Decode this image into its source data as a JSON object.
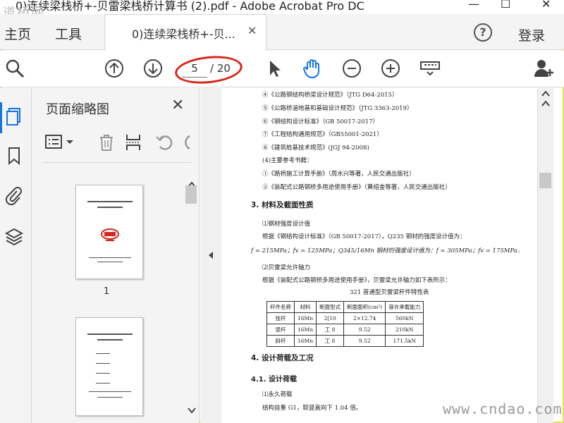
{
  "window": {
    "title": "0)连续梁栈桥+-贝雷梁栈桥计算书 (2).pdf - Adobe Acrobat Pro DC",
    "minimize": "—",
    "maximize": "☐",
    "close": "✕"
  },
  "watermark_top": "道桥网",
  "watermark_bottom": "www.cndao.com",
  "nav": {
    "home": "主页",
    "tools": "工具",
    "login": "登录",
    "help": "?"
  },
  "tab": {
    "label": "0)连续梁栈桥+-贝...",
    "close": "✕"
  },
  "toolbar": {
    "current_page": "5",
    "separator": "/",
    "total_pages": "20",
    "icons": [
      "search-icon",
      "page-up-icon",
      "page-down-icon",
      "select-arrow-icon",
      "hand-tool-icon",
      "zoom-out-icon",
      "zoom-in-icon",
      "scroll-mode-icon",
      "add-user-icon"
    ]
  },
  "rail": {
    "icons": [
      "page-thumbnails-icon",
      "bookmark-icon",
      "attachment-icon",
      "layers-icon"
    ]
  },
  "thumbnail_panel": {
    "title": "页面缩略图",
    "close": "✕",
    "pages": [
      {
        "number": "1"
      }
    ]
  },
  "document": {
    "refs": [
      "④《公路钢结构桥梁设计规范》（JTG D64-2015）",
      "⑤《公路桥涵地基和基础设计规范》（JTG 3363-2019）",
      "⑥《钢结构设计标准》（GB 50017-2017）",
      "⑦《工程结构通用规范》（GB55001-2021）",
      "⑧《建筑桩基技术规范》(JGJ 94-2008)",
      "(4)主要参考书籍：",
      "①《路桥施工计算手册》（周水兴等著，人民交通出版社）",
      "②《装配式公路钢桥多用途使用手册》（黄绍金等著，人民交通出版社）"
    ],
    "section3": "3.  材料及截面性质",
    "s3_l1": "⑴钢材强度设计值",
    "s3_l2": "根据《钢结构设计标准》（GB 50017-2017），Q235 钢材的强度设计值为：",
    "s3_formula": "f = 215MPa；fv = 125MPa；Q345/16Mn 钢材的强度设计值为：f = 305MPa；fv = 175MPa．",
    "s3_l3": "⑵贝雷梁允许轴力",
    "s3_l4": "根据《装配式公路钢桥多用途使用手册》，贝雷梁允许轴力如下表所示：",
    "table_title": "321 普通型贝雷梁杆件特性表",
    "table": {
      "headers": [
        "杆件名称",
        "材料",
        "断面型式",
        "断面面积(cm²)",
        "容许承载能力"
      ],
      "rows": [
        [
          "弦杆",
          "16Mn",
          "2[10",
          "2×12.74",
          "560kN"
        ],
        [
          "竖杆",
          "16Mn",
          "工 8",
          "9.52",
          "210kN"
        ],
        [
          "斜杆",
          "16Mn",
          "工 8",
          "9.52",
          "171.5kN"
        ]
      ]
    },
    "section4": "4.  设计荷载及工况",
    "section41": "4.1.  设计荷载",
    "s4_l1": "⑴永久荷载",
    "s4_l2": "结构自重 G1，取竖直向下 1.04 倍。"
  },
  "colors": {
    "accent": "#1473e6",
    "annotation": "#d9251a"
  }
}
